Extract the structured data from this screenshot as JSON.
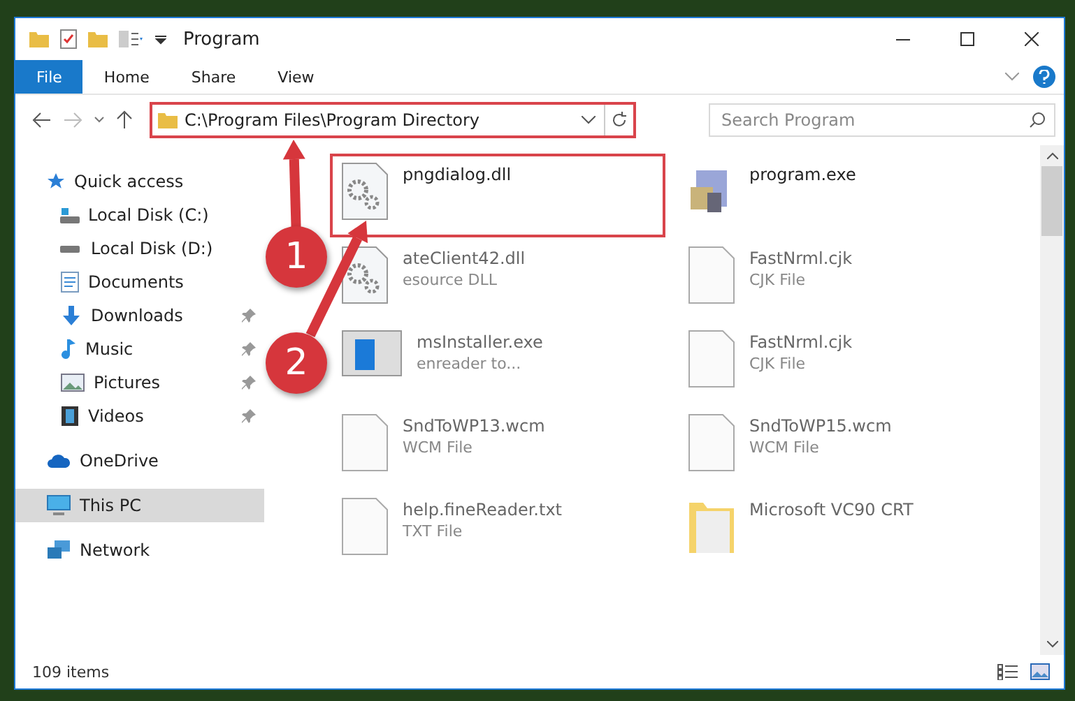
{
  "window": {
    "title": "Program"
  },
  "ribbon": {
    "tabs": [
      {
        "label": "File",
        "selected": true
      },
      {
        "label": "Home",
        "selected": false
      },
      {
        "label": "Share",
        "selected": false
      },
      {
        "label": "View",
        "selected": false
      }
    ]
  },
  "address_bar": {
    "path": "C:\\Program Files\\Program Directory",
    "highlighted": true
  },
  "search": {
    "placeholder": "Search Program"
  },
  "sidebar": {
    "items": [
      {
        "label": "Quick access",
        "kind": "star",
        "pinned": false,
        "selected": false,
        "group": true
      },
      {
        "label": "Local Disk (C:)",
        "kind": "disk-win",
        "pinned": false,
        "selected": false,
        "group": false
      },
      {
        "label": "Local Disk (D:)",
        "kind": "disk",
        "pinned": false,
        "selected": false,
        "group": false
      },
      {
        "label": "Documents",
        "kind": "doc",
        "pinned": false,
        "selected": false,
        "group": false
      },
      {
        "label": "Downloads",
        "kind": "down",
        "pinned": true,
        "selected": false,
        "group": false
      },
      {
        "label": "Music",
        "kind": "music",
        "pinned": true,
        "selected": false,
        "group": false
      },
      {
        "label": "Pictures",
        "kind": "pictures",
        "pinned": true,
        "selected": false,
        "group": false
      },
      {
        "label": "Videos",
        "kind": "videos",
        "pinned": true,
        "selected": false,
        "group": false
      },
      {
        "label": "OneDrive",
        "kind": "cloud",
        "pinned": false,
        "selected": false,
        "group": true
      },
      {
        "label": "This PC",
        "kind": "pc",
        "pinned": false,
        "selected": true,
        "group": true
      },
      {
        "label": "Network",
        "kind": "network",
        "pinned": false,
        "selected": false,
        "group": true
      }
    ]
  },
  "files": [
    {
      "name": "pngdialog.dll",
      "kind": "gear",
      "highlighted": true
    },
    {
      "name": "program.exe",
      "kind": "app",
      "highlighted": false
    },
    {
      "name": "ateClient42.dll",
      "type": "esource DLL",
      "kind": "gear",
      "highlighted": false
    },
    {
      "name": "FastNrml.cjk",
      "type": "CJK File",
      "kind": "blank",
      "highlighted": false
    },
    {
      "name": "msInstaller.exe",
      "type": "enreader to...",
      "kind": "installer",
      "highlighted": false
    },
    {
      "name": "FastNrml.cjk",
      "type": "CJK File",
      "kind": "blank",
      "highlighted": false
    },
    {
      "name": "SndToWP13.wcm",
      "type": "WCM File",
      "kind": "blank",
      "highlighted": false
    },
    {
      "name": "SndToWP15.wcm",
      "type": "WCM File",
      "kind": "blank",
      "highlighted": false
    },
    {
      "name": "help.fineReader.txt",
      "type": "TXT File",
      "kind": "blank",
      "highlighted": false
    },
    {
      "name": "Microsoft VC90 CRT",
      "kind": "folder",
      "highlighted": false
    }
  ],
  "annotations": [
    {
      "label": "1"
    },
    {
      "label": "2"
    }
  ],
  "status_bar": {
    "count": "109 items"
  }
}
